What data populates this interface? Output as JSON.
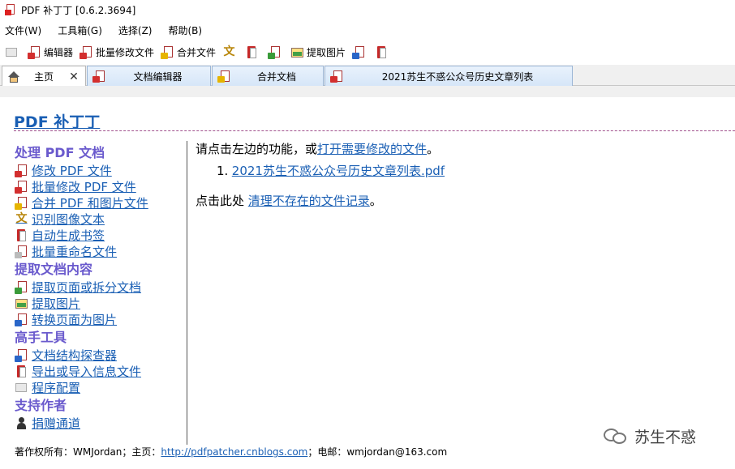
{
  "window": {
    "title": "PDF 补丁丁 [0.6.2.3694]"
  },
  "menubar": {
    "items": [
      "文件(W)",
      "工具箱(G)",
      "选择(Z)",
      "帮助(B)"
    ]
  },
  "toolbar": {
    "editor": "编辑器",
    "batch_modify": "批量修改文件",
    "merge": "合并文件",
    "extract_images": "提取图片"
  },
  "tabs": [
    {
      "label": "主页",
      "icon": "home-icon"
    },
    {
      "label": "文档编辑器",
      "icon": "pdf-edit-icon"
    },
    {
      "label": "合并文档",
      "icon": "merge-icon"
    },
    {
      "label": "2021苏生不惑公众号历史文章列表",
      "icon": "pdf-edit-icon"
    }
  ],
  "page": {
    "title": "PDF 补丁丁",
    "sections": [
      {
        "heading": "处理 PDF 文档",
        "links": [
          "修改 PDF 文件",
          "批量修改 PDF 文件",
          "合并 PDF 和图片文件",
          "识别图像文本",
          "自动生成书签",
          "批量重命名文件"
        ]
      },
      {
        "heading": "提取文档内容",
        "links": [
          "提取页面或拆分文档",
          "提取图片",
          "转换页面为图片"
        ]
      },
      {
        "heading": "高手工具",
        "links": [
          "文档结构探查器",
          "导出或导入信息文件",
          "程序配置"
        ]
      },
      {
        "heading": "支持作者",
        "links": [
          "捐赠通道"
        ]
      }
    ]
  },
  "main": {
    "prompt_prefix": "请点击左边的功能，或",
    "prompt_link": "打开需要修改的文件",
    "prompt_suffix": "。",
    "recent_number": "1.",
    "recent_file": "2021苏生不惑公众号历史文章列表.pdf",
    "cleanup_prefix": "点击此处 ",
    "cleanup_link": "清理不存在的文件记录",
    "cleanup_suffix": "。"
  },
  "footer": {
    "copyright": "著作权所有：WMJordan；主页：",
    "homepage": "http://pdfpatcher.cnblogs.com",
    "email_label": "；电邮：wmjordan@163.com"
  },
  "watermark": {
    "text": "苏生不惑"
  }
}
